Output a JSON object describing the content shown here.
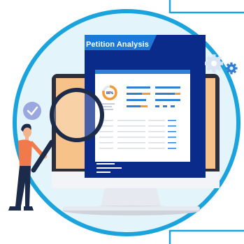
{
  "document": {
    "title": "Petition Analysis",
    "gauge_label": "80%"
  },
  "colors": {
    "ring": "#1aa3dc",
    "inner_circle": "#e4f4fb",
    "document_navy": "#0b2b8a",
    "accent_orange": "#f39a33",
    "accent_blue": "#2f7fd3",
    "check_badge": "#9aa8df",
    "gear": "#2f7fd3"
  },
  "icons": [
    "check-badge-icon",
    "gear-icon",
    "magnifying-glass-icon"
  ]
}
